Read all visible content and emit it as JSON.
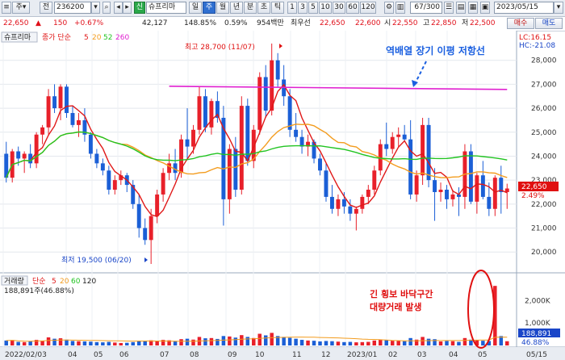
{
  "toolbar": {
    "menu_label": "주",
    "jeon_label": "전",
    "code": "236200",
    "credit_badge": "신",
    "name": "슈프리마",
    "periods": [
      "일",
      "주",
      "월",
      "년",
      "분",
      "초",
      "틱"
    ],
    "selected_period": "주",
    "intervals": [
      "1",
      "3",
      "5",
      "10",
      "30",
      "60",
      "120"
    ],
    "counter": "67/300",
    "date": "2023/05/15"
  },
  "quote": {
    "price": "22,650",
    "change": "150",
    "change_pct": "+0.67%",
    "volume": "42,127",
    "volume_pct": "148.85%",
    "turnover_pct": "0.59%",
    "amount": "954백만",
    "best_label": "최우선",
    "best_bid": "22,650",
    "best_ask": "22,600",
    "open_label": "시",
    "open": "22,550",
    "high_label": "고",
    "high": "22,850",
    "low_label": "저",
    "low": "22,500",
    "sell_label": "매수",
    "buy_label": "매도"
  },
  "legend": {
    "title": "슈프리마",
    "ma_label": "종가 단순",
    "ma_periods": [
      "5",
      "20",
      "52",
      "260"
    ],
    "vol_title": "거래량",
    "vol_ma_label": "단순",
    "vol_ma_periods": [
      "5",
      "20",
      "60",
      "120"
    ],
    "vol_value": "188,891주(46.88%)"
  },
  "indicators": {
    "lc": "LC:16.15",
    "hc": "HC:-21.08"
  },
  "annotations": {
    "high_label": "최고 28,700 (11/07)",
    "low_label": "최저 19,500 (06/20)",
    "resistance_label": "역배열 장기 이평 저항선",
    "volume_note_line1": "긴 횡보 바닥구간",
    "volume_note_line2": "대량거래 발생"
  },
  "price_tag": {
    "value": "22,650",
    "pct": "2.49%"
  },
  "volume_tag": {
    "value": "188,891",
    "pct": "46.88%"
  },
  "colors": {
    "up": "#e8202a",
    "down": "#1b5fd6",
    "ma5": "#e01818",
    "ma20": "#f39c1e",
    "ma52": "#22c422",
    "ma260": "#e020d0",
    "note": "#e01010",
    "resistance_label": "#1a5fe0"
  },
  "chart_data": {
    "type": "candlestick",
    "y_ticks": [
      "28,000",
      "27,000",
      "26,000",
      "25,000",
      "24,000",
      "23,000",
      "22,000",
      "21,000",
      "20,000"
    ],
    "vol_ticks": [
      "2,000K",
      "1,000K"
    ],
    "x_labels": [
      "2022/02/03",
      "04",
      "05",
      "06",
      "07",
      "08",
      "09",
      "10",
      "11",
      "12",
      "2023/01",
      "02",
      "03",
      "04",
      "05",
      "05/15"
    ],
    "ylim": [
      19400,
      28900
    ],
    "vol_max": 2800,
    "candles": [
      [
        24100,
        24600,
        22900,
        23100,
        220
      ],
      [
        23100,
        24300,
        22900,
        24200,
        240
      ],
      [
        24200,
        24400,
        23600,
        23900,
        160
      ],
      [
        23900,
        24200,
        23300,
        24100,
        150
      ],
      [
        24100,
        24500,
        23500,
        23700,
        180
      ],
      [
        23700,
        25000,
        23500,
        24900,
        250
      ],
      [
        24900,
        25300,
        24500,
        25200,
        210
      ],
      [
        25200,
        26800,
        24900,
        26500,
        360
      ],
      [
        26500,
        27000,
        25800,
        26000,
        300
      ],
      [
        26000,
        27000,
        25500,
        26900,
        320
      ],
      [
        26900,
        27000,
        25600,
        25800,
        260
      ],
      [
        25800,
        26100,
        25200,
        25300,
        200
      ],
      [
        25300,
        25800,
        24800,
        25500,
        190
      ],
      [
        25500,
        26000,
        24600,
        24900,
        180
      ],
      [
        24900,
        25000,
        23900,
        24100,
        170
      ],
      [
        24100,
        24300,
        23500,
        23700,
        150
      ],
      [
        23700,
        23900,
        23200,
        23400,
        140
      ],
      [
        23400,
        23600,
        22400,
        22600,
        160
      ],
      [
        22600,
        23200,
        22400,
        23000,
        130
      ],
      [
        23000,
        23400,
        22800,
        23200,
        110
      ],
      [
        23200,
        23300,
        22500,
        22800,
        120
      ],
      [
        22800,
        23000,
        21800,
        22000,
        150
      ],
      [
        22000,
        22400,
        20600,
        21000,
        190
      ],
      [
        21000,
        21400,
        20300,
        20500,
        180
      ],
      [
        20500,
        21800,
        19500,
        21500,
        230
      ],
      [
        21500,
        22600,
        21200,
        22400,
        210
      ],
      [
        22400,
        23500,
        22100,
        23300,
        250
      ],
      [
        23300,
        24100,
        23000,
        23700,
        230
      ],
      [
        23700,
        24300,
        23000,
        23300,
        200
      ],
      [
        23300,
        24900,
        23100,
        24700,
        280
      ],
      [
        24700,
        26000,
        23900,
        24400,
        300
      ],
      [
        24400,
        25300,
        24100,
        25100,
        260
      ],
      [
        25100,
        26900,
        24900,
        26500,
        380
      ],
      [
        26500,
        26800,
        25000,
        25200,
        320
      ],
      [
        25200,
        26400,
        24900,
        26300,
        330
      ],
      [
        26300,
        26700,
        25400,
        25600,
        290
      ],
      [
        25600,
        26100,
        21100,
        22200,
        420
      ],
      [
        22200,
        24500,
        21600,
        24300,
        400
      ],
      [
        24300,
        24800,
        22300,
        22600,
        350
      ],
      [
        22600,
        26500,
        22400,
        26100,
        460
      ],
      [
        26100,
        26400,
        23600,
        23800,
        380
      ],
      [
        23800,
        25300,
        23500,
        25100,
        330
      ],
      [
        25100,
        27500,
        24900,
        27300,
        520
      ],
      [
        27300,
        27800,
        25600,
        25900,
        450
      ],
      [
        25900,
        28700,
        25700,
        28000,
        560
      ],
      [
        28000,
        28300,
        26900,
        27200,
        420
      ],
      [
        27200,
        27800,
        26100,
        26500,
        380
      ],
      [
        26500,
        26800,
        24800,
        25100,
        340
      ],
      [
        25100,
        25800,
        24600,
        24800,
        300
      ],
      [
        24800,
        25100,
        24100,
        24400,
        250
      ],
      [
        24400,
        24900,
        24000,
        24600,
        220
      ],
      [
        24600,
        24700,
        23700,
        23900,
        210
      ],
      [
        23900,
        24100,
        23200,
        23400,
        180
      ],
      [
        23400,
        23700,
        22100,
        22300,
        200
      ],
      [
        22300,
        22800,
        21600,
        21800,
        190
      ],
      [
        21800,
        22400,
        21500,
        22200,
        170
      ],
      [
        22200,
        22500,
        21600,
        21900,
        150
      ],
      [
        21900,
        22200,
        21300,
        21600,
        160
      ],
      [
        21600,
        21900,
        20900,
        21800,
        140
      ],
      [
        21800,
        22400,
        21600,
        22300,
        150
      ],
      [
        22300,
        22800,
        22000,
        22600,
        160
      ],
      [
        22600,
        23600,
        22400,
        23400,
        220
      ],
      [
        23400,
        24700,
        23200,
        24500,
        260
      ],
      [
        24500,
        25400,
        24000,
        24300,
        240
      ],
      [
        24300,
        25000,
        24100,
        24800,
        210
      ],
      [
        24800,
        25200,
        24400,
        24900,
        200
      ],
      [
        24900,
        25300,
        24600,
        24700,
        190
      ],
      [
        24700,
        25500,
        22200,
        22400,
        330
      ],
      [
        22400,
        23400,
        22100,
        23200,
        260
      ],
      [
        23200,
        25600,
        22800,
        25300,
        380
      ],
      [
        25300,
        25600,
        22700,
        23000,
        300
      ],
      [
        23000,
        23500,
        21300,
        22500,
        280
      ],
      [
        22500,
        22900,
        22100,
        22600,
        180
      ],
      [
        22600,
        22800,
        21800,
        22200,
        200
      ],
      [
        22200,
        22600,
        21900,
        22400,
        190
      ],
      [
        22400,
        22700,
        21500,
        22300,
        160
      ],
      [
        22300,
        24500,
        21800,
        24200,
        330
      ],
      [
        24200,
        24500,
        22000,
        22100,
        260
      ],
      [
        22100,
        23300,
        21600,
        23200,
        250
      ],
      [
        23200,
        23800,
        22200,
        22300,
        210
      ],
      [
        22300,
        22900,
        21500,
        21800,
        200
      ],
      [
        21800,
        23200,
        21500,
        23100,
        2650
      ],
      [
        23100,
        23600,
        21600,
        22500,
        420
      ],
      [
        22500,
        22850,
        21800,
        22650,
        189
      ]
    ],
    "resistance_level": 26850
  }
}
